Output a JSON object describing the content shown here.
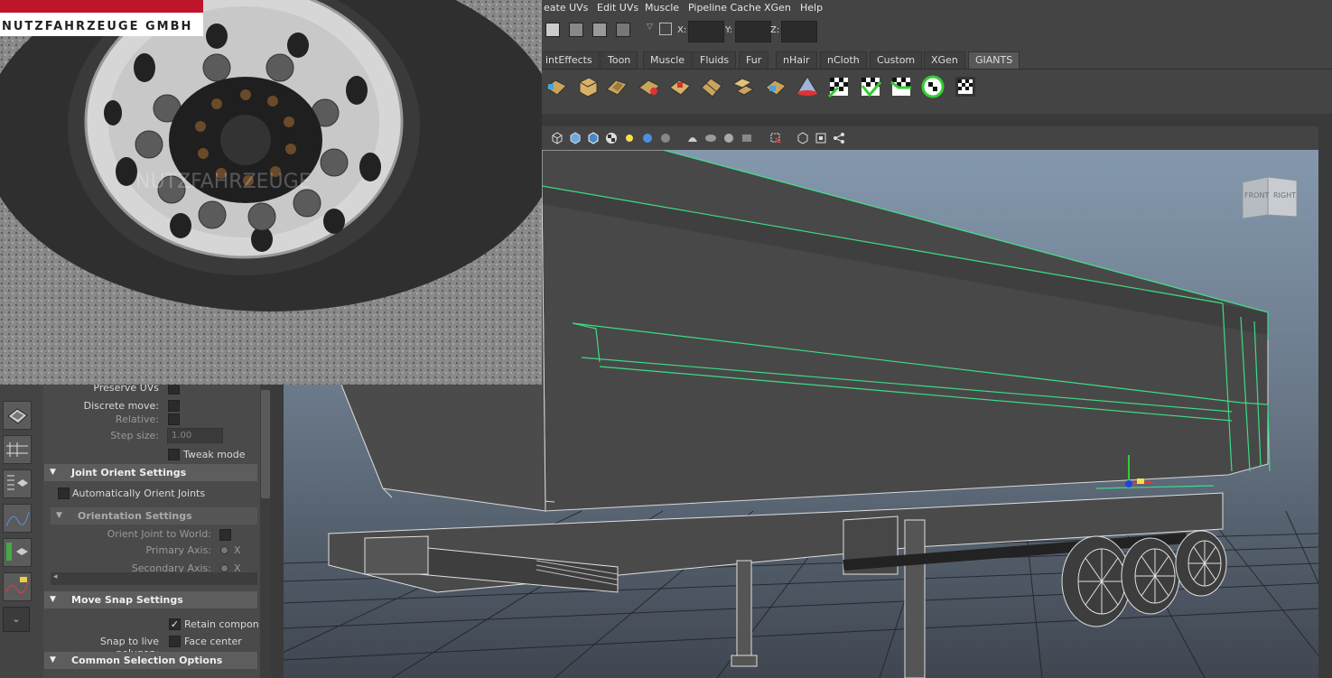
{
  "menubar": {
    "items": [
      "eate UVs",
      "Edit UVs",
      "Muscle",
      "Pipeline Cache",
      "XGen",
      "Help"
    ]
  },
  "statusline": {
    "x_label": "X:",
    "y_label": "Y:",
    "z_label": "Z:",
    "x_value": "",
    "y_value": "",
    "z_value": ""
  },
  "shelf": {
    "tabs": [
      "intEffects",
      "Toon",
      "Muscle",
      "Fluids",
      "Fur",
      "nHair",
      "nCloth",
      "Custom",
      "XGen",
      "GIANTS"
    ],
    "active_tab": "GIANTS",
    "icons": [
      "uv-plane-icon",
      "uv-cube-icon",
      "uv-cylinder-icon",
      "uv-unfold-icon",
      "uv-layout-icon",
      "uv-cut-icon",
      "uv-sew-icon",
      "uv-move-icon",
      "uv-normalize-icon",
      "uv-flip-icon",
      "checker-icon-1",
      "checker-icon-2",
      "checker-icon-3",
      "checker-icon-4",
      "checker-icon-5"
    ]
  },
  "viewport": {
    "viewcube_front": "FRONT",
    "viewcube_right": "RIGHT",
    "colors": {
      "wire": "#d8d8d8",
      "selected": "#3ddc84",
      "grid": "#1f2226"
    }
  },
  "photo": {
    "brand_lettering": "NUTZFAHRZEUGE GMBH",
    "watermark": "NUTZFAHRZEUGE"
  },
  "attributes": {
    "preserve_uvs": "Preserve UVs",
    "discrete_move": "Discrete move:",
    "relative": "Relative:",
    "step_size": "Step size:",
    "step_size_value": "1.00",
    "tweak_mode": "Tweak mode",
    "joint_orient_header": "Joint Orient Settings",
    "auto_orient": "Automatically Orient Joints",
    "orientation_header": "Orientation Settings",
    "orient_to_world": "Orient Joint to World:",
    "primary_axis": "Primary Axis:",
    "primary_axis_value": "X",
    "secondary_axis": "Secondary Axis:",
    "secondary_axis_value": "X",
    "move_snap_header": "Move Snap Settings",
    "retain_component": "Retain componen",
    "snap_live": "Snap to live polygon:",
    "face_center": "Face center",
    "common_selection_header": "Common Selection Options"
  }
}
